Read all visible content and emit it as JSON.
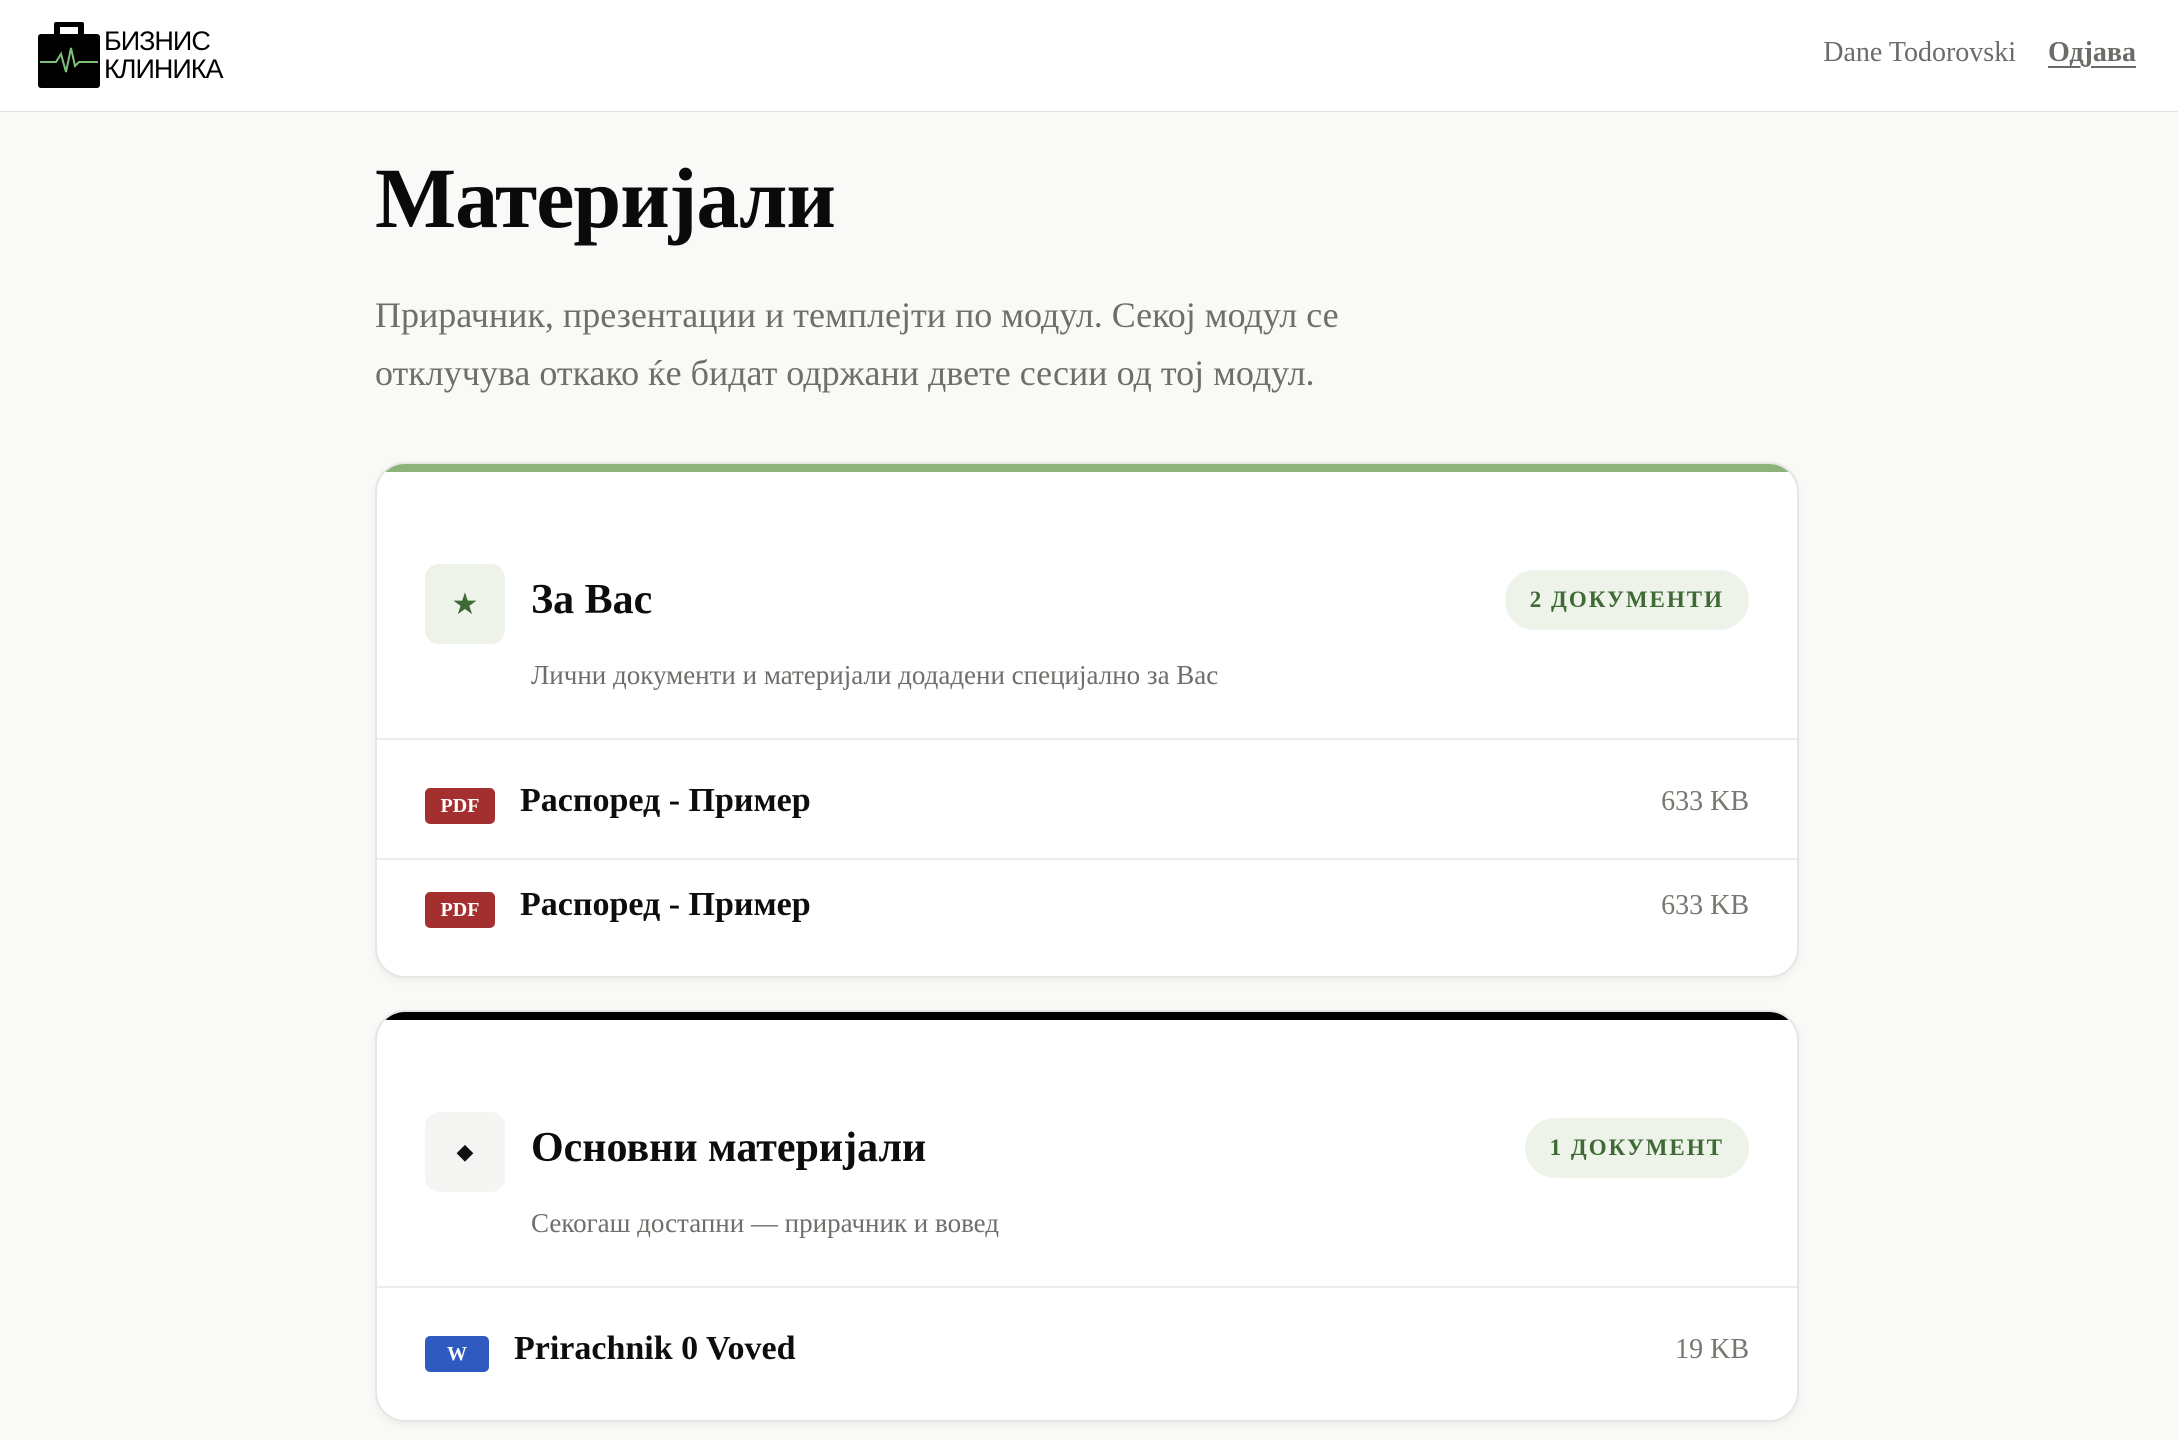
{
  "header": {
    "logo_line1": "БИЗНИС",
    "logo_line2": "КЛИНИКА",
    "user_name": "Dane Todorovski",
    "logout_label": "Одјава"
  },
  "page": {
    "title": "Материјали",
    "description": "Прирачник, презентации и темплејти по модул. Секој модул се отклучува откако ќе бидат одржани двете сесии од тој модул."
  },
  "sections": [
    {
      "icon": "★",
      "icon_name": "star-icon",
      "title": "За Вас",
      "subtitle": "Лични документи и материјали додадени специјално за Вас",
      "badge": "2 ДОКУМЕНТИ",
      "accent": "#8db37a",
      "files": [
        {
          "type": "PDF",
          "type_color": "#a3302e",
          "name": "Распоред - Пример",
          "size": "633 KB"
        },
        {
          "type": "PDF",
          "type_color": "#a3302e",
          "name": "Распоред - Пример",
          "size": "633 KB"
        }
      ]
    },
    {
      "icon": "◆",
      "icon_name": "diamond-icon",
      "title": "Основни материјали",
      "subtitle": "Секогаш достапни — прирачник и вовед",
      "badge": "1 ДОКУМЕНТ",
      "accent": "#000000",
      "files": [
        {
          "type": "W",
          "type_color": "#2f5bc0",
          "name": "Prirachnik 0 Voved",
          "size": "19 KB"
        }
      ]
    }
  ],
  "colors": {
    "background": "#f9f9f7",
    "badge_bg": "#eef3ea",
    "badge_text": "#3f6a35",
    "muted_text": "#6e6e6a"
  }
}
